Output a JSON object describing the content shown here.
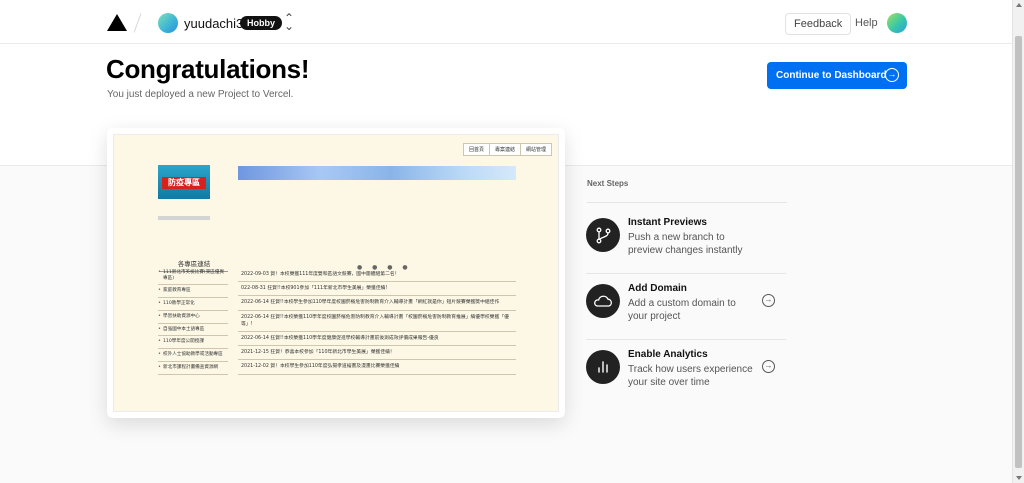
{
  "header": {
    "team_name": "yuudachi31",
    "plan_badge": "Hobby",
    "switch_icon": "chevron-up-down-icon",
    "feedback_label": "Feedback",
    "help_label": "Help"
  },
  "hero": {
    "title": "Congratulations!",
    "subtitle": "You just deployed a new Project to Vercel.",
    "cta_label": "Continue to Dashboard",
    "cta_icon": "arrow-right-circle-icon",
    "accent": "#0070f3"
  },
  "preview": {
    "nav": [
      "回首頁",
      "專案連結",
      "網站管理"
    ],
    "logo_text": "防疫專區",
    "dots": "● ● ● ●",
    "side_title": "各專區連結",
    "side_links": [
      "111新北市英檢比賽(東區優異專區)",
      "家庭教育專區",
      "110教學正常化",
      "學習扶助資源中心",
      "自強國中本土語專區",
      "110學年度公開授課",
      "校外人士協助教學或活動專區",
      "新北市課程計畫備查資源網"
    ],
    "news": [
      "2022-09-03 賀！本校榮獲111年度雙和區語文競賽，國中團體組第二名！",
      "022-08-31 狂賀!!本校901參加「111年新北市學生美展」榮獲佳績!",
      "2022-06-14 狂賀!!本校學生參加110學年度校園菸檳危害防制教育介入輔導計畫「網紅就是你」短片競賽榮獲獎中組佳作",
      "2022-06-14 狂賀!!本校榮獲110學年度校園菸檳危害防制教育介入輔導計畫「校園菸檳危害防制教育推展」績優學校榮獲「優等」!",
      "2022-06-14 狂賀!!本校榮獲110學年度健康促進學校輔導計畫前後測成效評價成果報告-優良",
      "2021-12-15 狂賀！恭喜本校參加「110年新北市學生美展」榮獲佳績！",
      "2021-12-02 賀！本校學生參加110年度弘揚孝道繪畫及漫畫比賽榮獲佳績"
    ]
  },
  "next_steps": {
    "title": "Next Steps",
    "items": [
      {
        "title": "Instant Previews",
        "desc": "Push a new branch to preview changes instantly",
        "icon": "git-branch-icon",
        "has_arrow": false
      },
      {
        "title": "Add Domain",
        "desc": "Add a custom domain to your project",
        "icon": "cloud-icon",
        "has_arrow": true
      },
      {
        "title": "Enable Analytics",
        "desc": "Track how users experience your site over time",
        "icon": "bar-chart-icon",
        "has_arrow": true
      }
    ]
  }
}
